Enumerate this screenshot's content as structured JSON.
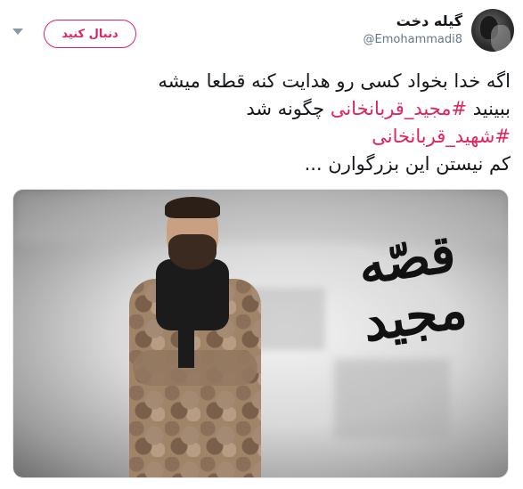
{
  "header": {
    "display_name": "گیله دخت",
    "handle": "@Emohammadi8",
    "follow_label": "دنبال کنید"
  },
  "tweet": {
    "line1": "اگه خدا بخواد کسی رو هدایت کنه قطعا میشه",
    "line2_prefix": "ببینید ",
    "line2_hashtag": "#مجید_قربانخانی",
    "line2_suffix": " چگونه شد",
    "line3_hashtag": "#شهید_قربانخانی",
    "line4": "کم نیستن این بزرگوارن ..."
  },
  "media": {
    "title_text": "قصّه مجید"
  },
  "icons": {
    "more": "chevron-down-icon",
    "avatar": "avatar"
  },
  "colors": {
    "accent": "#e0245e",
    "text": "#14171a",
    "muted": "#657786"
  }
}
